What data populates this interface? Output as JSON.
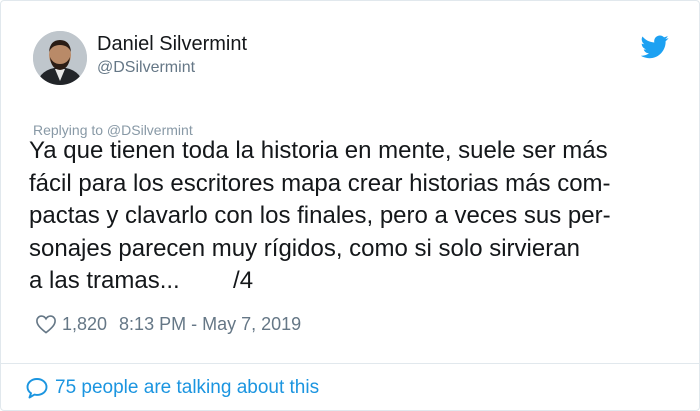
{
  "author": {
    "name": "Daniel Silvermint",
    "handle": "@DSilvermint"
  },
  "reply": {
    "label": "Replying to @DSilvermint"
  },
  "tweet": {
    "lines": [
      "Ya que tienen toda la historia en mente, suele ser más",
      "fácil para los escritores mapa crear historias más com-",
      "pactas y clavarlo con los finales, pero a veces sus per-",
      "sonajes parecen muy rígidos, como si solo sirvieran",
      "a las tramas...        /4"
    ]
  },
  "meta": {
    "like_count": "1,820",
    "timestamp": "8:13 PM - May 7, 2019"
  },
  "footer": {
    "talking": "75 people are talking about this"
  },
  "colors": {
    "accent": "#1da1f2",
    "link": "#1b95e0",
    "muted": "#657786",
    "text": "#14171a",
    "border": "#e1e8ed"
  },
  "icons": {
    "brand": "twitter-bird-icon",
    "like": "heart-icon",
    "reply": "speech-bubble-icon"
  }
}
